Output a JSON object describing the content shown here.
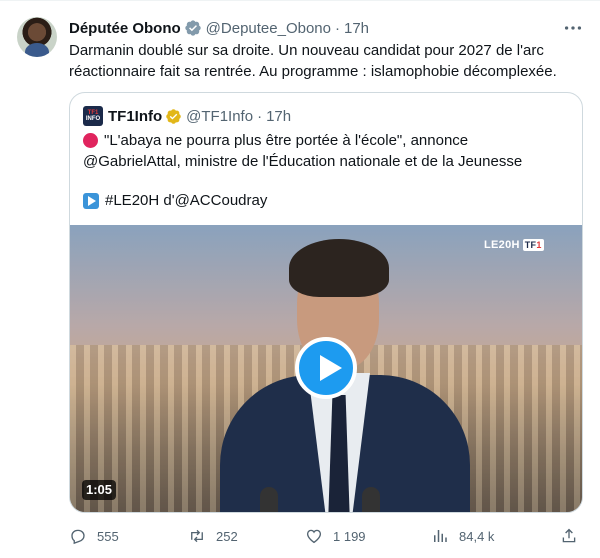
{
  "author": {
    "name": "Députée Obono",
    "handle": "@Deputee_Obono",
    "separator": "·",
    "time": "17h"
  },
  "tweet_text": "Darmanin doublé sur sa droite. Un nouveau candidat pour 2027 de l'arc réactionnaire fait sa rentrée. Au programme : islamophobie décomplexée.",
  "quoted": {
    "logo_top": "TF1",
    "logo_bottom": "INFO",
    "name": "TF1Info",
    "handle": "@TF1Info",
    "separator": "·",
    "time": "17h",
    "line1": "\"L'abaya ne pourra plus être portée à l'école\", annonce",
    "line2": "@GabrielAttal, ministre de l'Éducation nationale et de la Jeunesse",
    "line3": "#LE20H d'@ACCoudray",
    "video": {
      "channel_label": "LE20H",
      "channel_logo_a": "TF",
      "channel_logo_b": "1",
      "duration": "1:05"
    }
  },
  "actions": {
    "replies": "555",
    "reposts": "252",
    "likes": "1 199",
    "views": "84,4 k"
  },
  "colors": {
    "accent": "#1d9bf0",
    "muted": "#536471",
    "border": "#cfd9de",
    "verified_gray": "#829aab",
    "verified_gold": "#e2b719"
  }
}
